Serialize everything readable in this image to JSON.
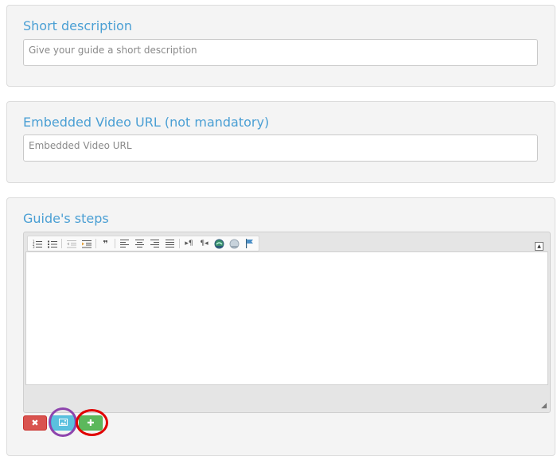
{
  "short_description": {
    "heading": "Short description",
    "placeholder": "Give your guide a short description"
  },
  "video": {
    "heading": "Embedded Video URL (not mandatory)",
    "placeholder": "Embedded Video URL"
  },
  "steps": {
    "heading": "Guide's steps",
    "toolbar_icons": [
      "numbered-list-icon",
      "bulleted-list-icon",
      "outdent-icon",
      "indent-icon",
      "blockquote-icon",
      "align-left-icon",
      "align-center-icon",
      "align-right-icon",
      "justify-icon",
      "ltr-icon",
      "rtl-icon",
      "link-icon",
      "unlink-icon",
      "anchor-icon"
    ],
    "collapse_glyph": "▲",
    "buttons": {
      "delete_glyph": "✖",
      "add_glyph": "✚"
    }
  },
  "colors": {
    "heading": "#4a9fd4",
    "delete": "#d9534f",
    "image": "#5bc0de",
    "add": "#5cb85c",
    "ring_purple": "#8e44ad",
    "ring_red": "#e00000"
  }
}
